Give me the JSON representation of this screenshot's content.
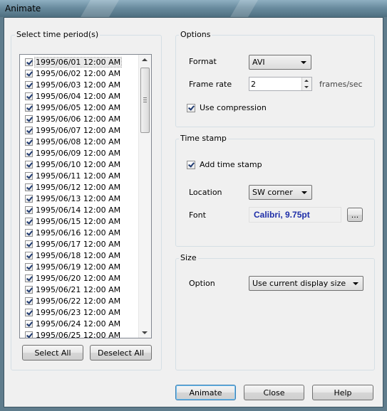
{
  "window": {
    "title": "Animate"
  },
  "time_period": {
    "legend": "Select time period(s)",
    "items": [
      "1995/06/01 12:00 AM",
      "1995/06/02 12:00 AM",
      "1995/06/03 12:00 AM",
      "1995/06/04 12:00 AM",
      "1995/06/05 12:00 AM",
      "1995/06/06 12:00 AM",
      "1995/06/07 12:00 AM",
      "1995/06/08 12:00 AM",
      "1995/06/09 12:00 AM",
      "1995/06/10 12:00 AM",
      "1995/06/11 12:00 AM",
      "1995/06/12 12:00 AM",
      "1995/06/13 12:00 AM",
      "1995/06/14 12:00 AM",
      "1995/06/15 12:00 AM",
      "1995/06/16 12:00 AM",
      "1995/06/17 12:00 AM",
      "1995/06/18 12:00 AM",
      "1995/06/19 12:00 AM",
      "1995/06/20 12:00 AM",
      "1995/06/21 12:00 AM",
      "1995/06/22 12:00 AM",
      "1995/06/23 12:00 AM",
      "1995/06/24 12:00 AM",
      "1995/06/25 12:00 AM"
    ],
    "select_all_label": "Select All",
    "deselect_all_label": "Deselect All"
  },
  "options": {
    "legend": "Options",
    "format_label": "Format",
    "format_value": "AVI",
    "frame_rate_label": "Frame rate",
    "frame_rate_value": "2",
    "frame_rate_unit": "frames/sec",
    "use_compression_label": "Use compression",
    "use_compression_checked": true
  },
  "time_stamp": {
    "legend": "Time stamp",
    "add_time_stamp_label": "Add time stamp",
    "add_time_stamp_checked": true,
    "location_label": "Location",
    "location_value": "SW corner",
    "font_label": "Font",
    "font_value": "Calibri, 9.75pt",
    "font_button_label": "..."
  },
  "size": {
    "legend": "Size",
    "option_label": "Option",
    "option_value": "Use current display size"
  },
  "footer": {
    "animate_label": "Animate",
    "close_label": "Close",
    "help_label": "Help"
  },
  "colors": {
    "font_preview": "#1e2ea8",
    "default_button_border": "#3c7fb1"
  }
}
